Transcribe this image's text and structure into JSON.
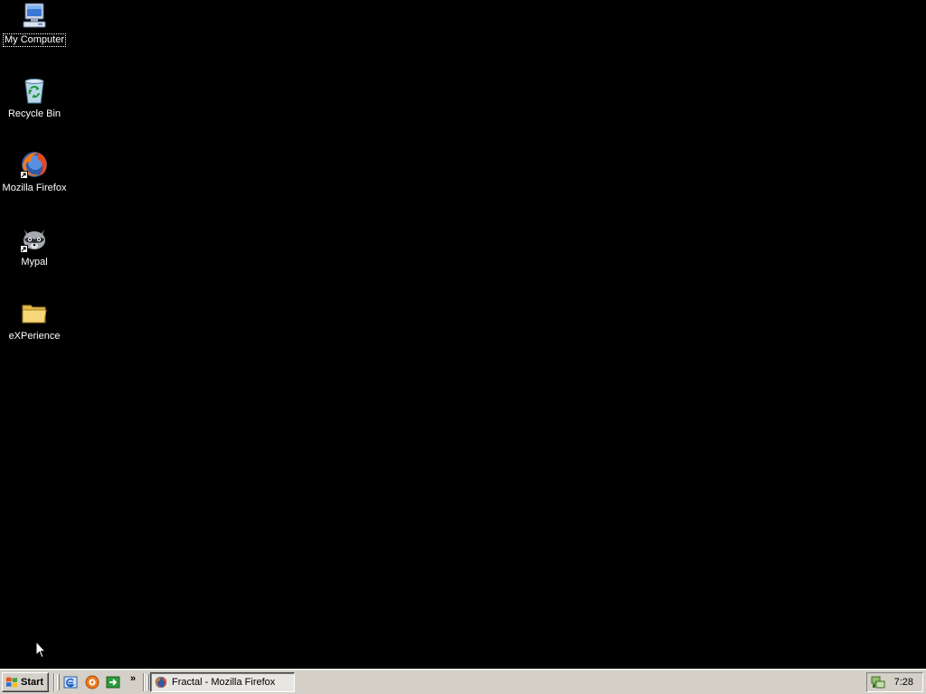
{
  "desktop": {
    "background_color": "#000000",
    "icons": [
      {
        "label": "My Computer",
        "icon": "my-computer-icon",
        "selected": true
      },
      {
        "label": "Recycle Bin",
        "icon": "recycle-bin-icon"
      },
      {
        "label": "Mozilla Firefox",
        "icon": "firefox-icon",
        "shortcut": true
      },
      {
        "label": "Mypal",
        "icon": "mypal-raccoon-icon",
        "shortcut": true
      },
      {
        "label": "eXPerience",
        "icon": "folder-icon"
      }
    ]
  },
  "taskbar": {
    "background_color": "#d4d0c8",
    "start_label": "Start",
    "quick_launch": [
      {
        "icon": "internet-explorer-icon"
      },
      {
        "icon": "media-player-icon"
      },
      {
        "icon": "show-desktop-icon"
      }
    ],
    "overflow_label": "»",
    "tasks": [
      {
        "label": "Fractal - Mozilla Firefox",
        "icon": "firefox-icon",
        "active": true
      }
    ],
    "tray": {
      "icon": "network-icon",
      "clock": "7:28"
    }
  }
}
